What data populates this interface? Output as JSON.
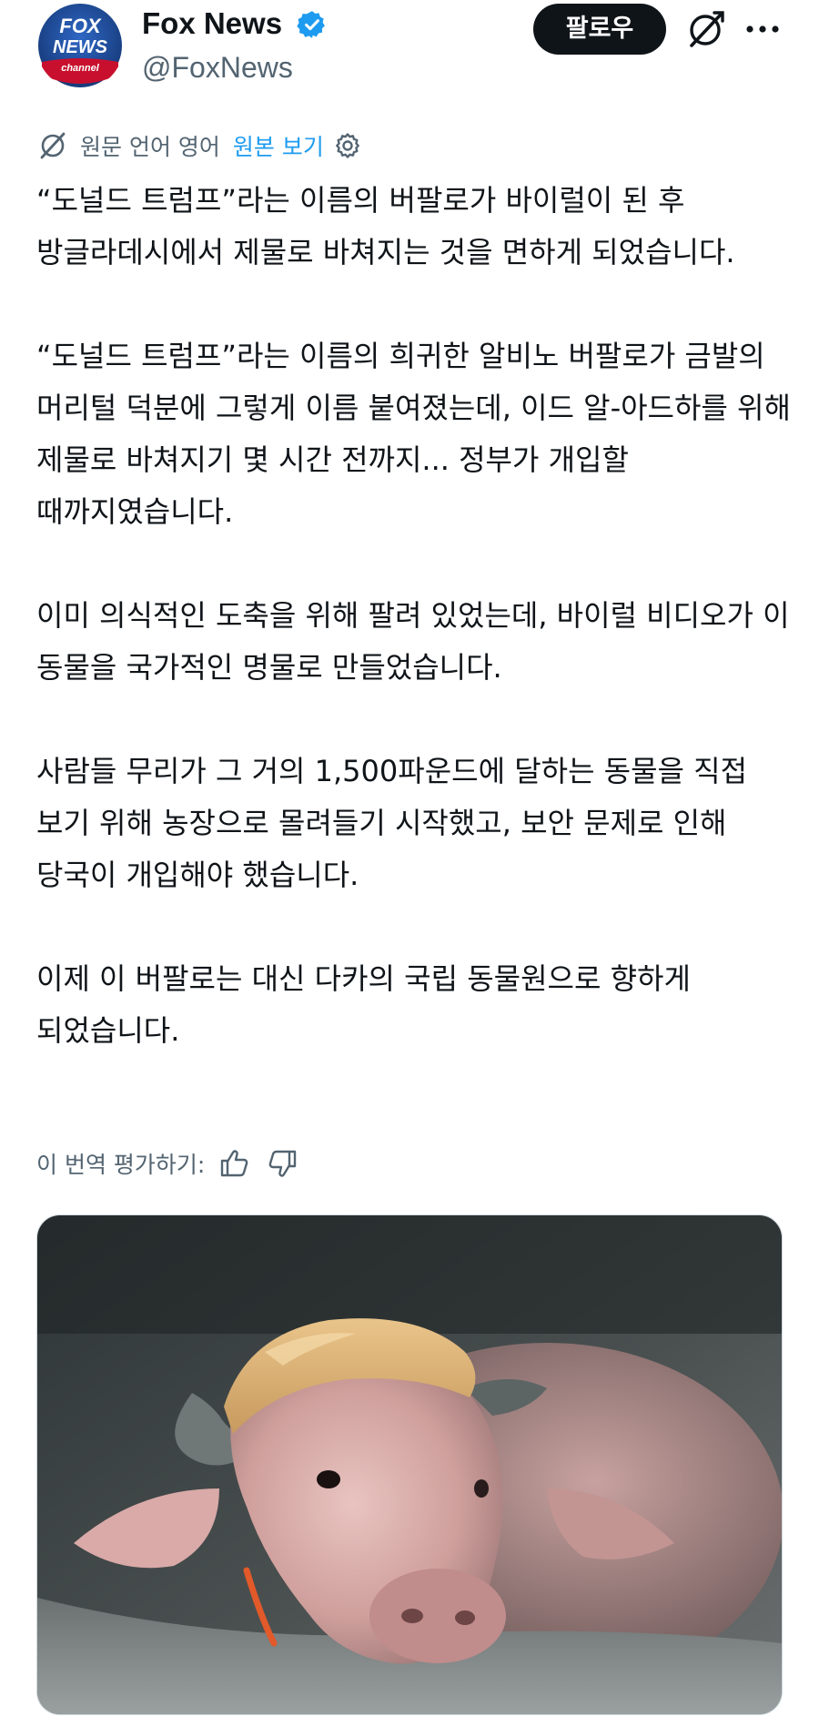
{
  "author": {
    "display_name": "Fox News",
    "handle": "@FoxNews",
    "avatar_logo": {
      "line1": "FOX",
      "line2": "NEWS",
      "line3": "channel"
    },
    "verified_icon": "verified-badge-icon"
  },
  "actions": {
    "follow_label": "팔로우",
    "grok_icon": "grok-icon",
    "more_icon": "more-dots-icon"
  },
  "translation": {
    "source_label": "원문 언어 영어",
    "view_original_label": "원본 보기"
  },
  "tweet": {
    "paragraphs": [
      "“도널드 트럼프”라는 이름의 버팔로가 바이럴이 된 후 방글라데시에서 제물로 바쳐지는 것을 면하게 되었습니다.",
      "“도널드 트럼프”라는 이름의 희귀한 알비노 버팔로가 금발의 머리털 덕분에 그렇게 이름 붙여졌는데, 이드 알-아드하를 위해 제물로 바쳐지기 몇 시간 전까지... 정부가 개입할 때까지였습니다.",
      "이미 의식적인 도축을 위해 팔려 있었는데, 바이럴 비디오가 이 동물을 국가적인 명물로 만들었습니다.",
      "사람들 무리가 그 거의 1,500파운드에 달하는 동물을 직접 보기 위해 농장으로 몰려들기 시작했고, 보안 문제로 인해 당국이 개입해야 했습니다.",
      "이제 이 버팔로는 대신 다카의 국립 동물원으로 향하게 되었습니다."
    ]
  },
  "rating": {
    "label": "이 번역 평가하기:",
    "like_icon": "thumbs-up-icon",
    "dislike_icon": "thumbs-down-icon"
  },
  "media": {
    "kind": "photo",
    "subject": "albino-buffalo-photo"
  },
  "colors": {
    "text": "#0f1419",
    "secondary": "#536471",
    "link": "#1d9bf0",
    "fox_blue": "#1f4e9d",
    "fox_red": "#c8102e",
    "follow_bg": "#0f1419"
  }
}
